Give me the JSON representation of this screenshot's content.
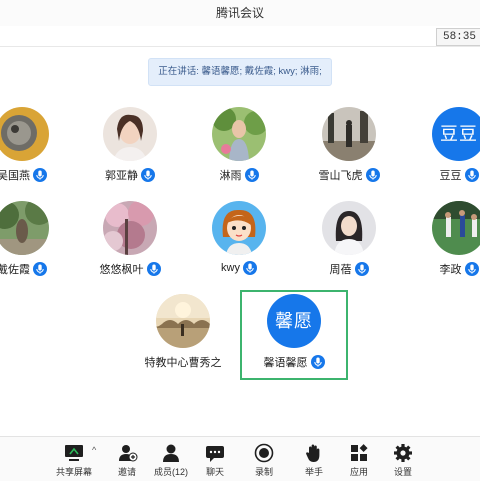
{
  "window": {
    "title": "腾讯会议",
    "timer": "58:35"
  },
  "speaking": {
    "text": "正在讲话: 馨语馨愿; 戴佐霞; kwy; 淋雨;"
  },
  "participants": [
    {
      "name": "吴国燕",
      "avatar_text": ""
    },
    {
      "name": "郭亚静",
      "avatar_text": ""
    },
    {
      "name": "淋雨",
      "avatar_text": ""
    },
    {
      "name": "雪山飞虎",
      "avatar_text": ""
    },
    {
      "name": "豆豆",
      "avatar_text": "豆豆"
    },
    {
      "name": "戴佐霞",
      "avatar_text": ""
    },
    {
      "name": "悠悠枫叶",
      "avatar_text": ""
    },
    {
      "name": "kwy",
      "avatar_text": ""
    },
    {
      "name": "周蓓",
      "avatar_text": ""
    },
    {
      "name": "李政",
      "avatar_text": ""
    },
    {
      "name": "特教中心曹秀之",
      "avatar_text": ""
    },
    {
      "name": "馨语馨愿",
      "avatar_text": "馨愿"
    }
  ],
  "toolbar": {
    "share": "共享屏幕",
    "invite": "邀请",
    "members": "成员(12)",
    "chat": "聊天",
    "record": "录制",
    "raise_hand": "举手",
    "apps": "应用",
    "settings": "设置"
  },
  "colors": {
    "accent": "#1677ea",
    "active_speaker_border": "#3cb46e",
    "speaking_bg": "#e4eefb"
  }
}
